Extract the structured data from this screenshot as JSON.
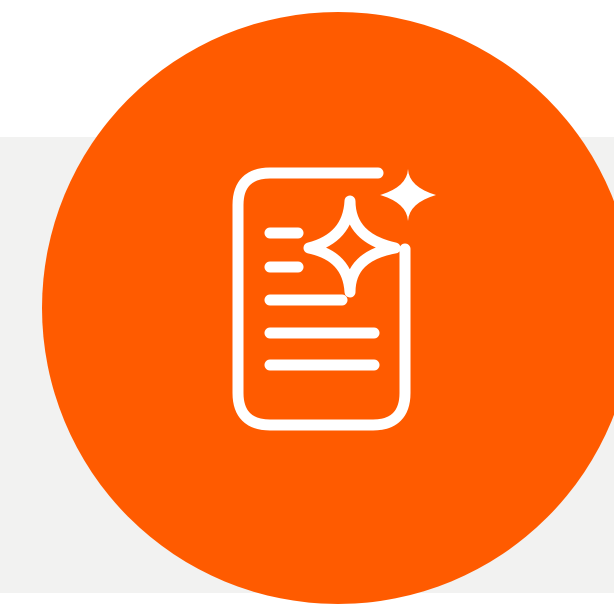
{
  "colors": {
    "background_top": "#ffffff",
    "background_bottom": "#f2f2f1",
    "accent_circle": "#ff5b00",
    "icon_stroke": "#ffffff"
  },
  "icon": {
    "name": "ai-document-sparkle-icon"
  }
}
